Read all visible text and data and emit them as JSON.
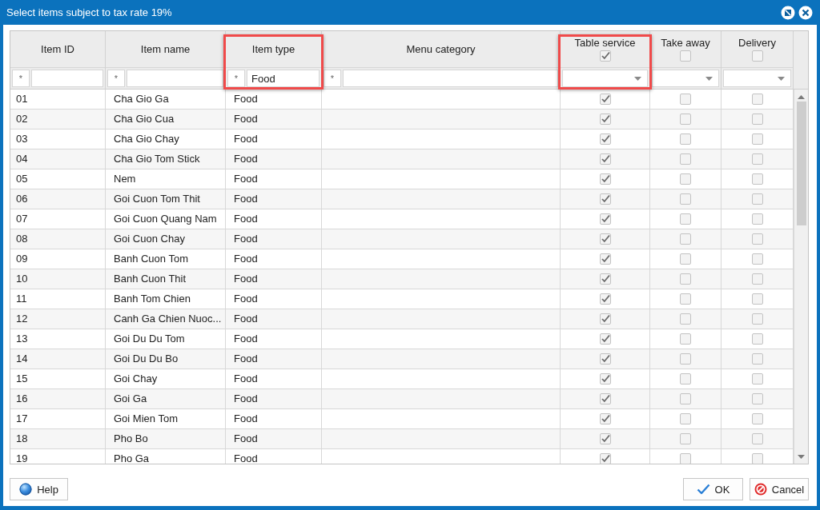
{
  "window": {
    "title": "Select items subject to tax rate 19%"
  },
  "table": {
    "columns": [
      {
        "label": "Item ID",
        "kind": "text",
        "highlighted": false,
        "filter": {
          "operator": "*"
        }
      },
      {
        "label": "Item name",
        "kind": "text",
        "highlighted": false,
        "filter": {
          "operator": "*"
        }
      },
      {
        "label": "Item type",
        "kind": "text",
        "highlighted": true,
        "filter": {
          "operator": "*",
          "value": "Food"
        }
      },
      {
        "label": "Menu category",
        "kind": "text",
        "highlighted": false,
        "filter": {
          "operator": "*"
        }
      },
      {
        "label": "Table service",
        "kind": "check",
        "checked": true,
        "highlighted": true
      },
      {
        "label": "Take away",
        "kind": "check",
        "checked": false,
        "highlighted": false
      },
      {
        "label": "Delivery",
        "kind": "check",
        "checked": false,
        "highlighted": false
      }
    ],
    "rows": [
      {
        "item_id": "01",
        "item_name": "Cha Gio Ga",
        "item_type": "Food",
        "table_service": true,
        "take_away": false,
        "delivery": false
      },
      {
        "item_id": "02",
        "item_name": "Cha Gio Cua",
        "item_type": "Food",
        "table_service": true,
        "take_away": false,
        "delivery": false
      },
      {
        "item_id": "03",
        "item_name": "Cha Gio Chay",
        "item_type": "Food",
        "table_service": true,
        "take_away": false,
        "delivery": false
      },
      {
        "item_id": "04",
        "item_name": "Cha Gio Tom Stick",
        "item_type": "Food",
        "table_service": true,
        "take_away": false,
        "delivery": false
      },
      {
        "item_id": "05",
        "item_name": "Nem",
        "item_type": "Food",
        "table_service": true,
        "take_away": false,
        "delivery": false
      },
      {
        "item_id": "06",
        "item_name": "Goi Cuon Tom Thit",
        "item_type": "Food",
        "table_service": true,
        "take_away": false,
        "delivery": false
      },
      {
        "item_id": "07",
        "item_name": "Goi Cuon Quang Nam",
        "item_type": "Food",
        "table_service": true,
        "take_away": false,
        "delivery": false
      },
      {
        "item_id": "08",
        "item_name": "Goi Cuon Chay",
        "item_type": "Food",
        "table_service": true,
        "take_away": false,
        "delivery": false
      },
      {
        "item_id": "09",
        "item_name": "Banh Cuon Tom",
        "item_type": "Food",
        "table_service": true,
        "take_away": false,
        "delivery": false
      },
      {
        "item_id": "10",
        "item_name": "Banh Cuon Thit",
        "item_type": "Food",
        "table_service": true,
        "take_away": false,
        "delivery": false
      },
      {
        "item_id": "11",
        "item_name": "Banh Tom Chien",
        "item_type": "Food",
        "table_service": true,
        "take_away": false,
        "delivery": false
      },
      {
        "item_id": "12",
        "item_name": "Canh Ga Chien Nuoc...",
        "item_type": "Food",
        "table_service": true,
        "take_away": false,
        "delivery": false
      },
      {
        "item_id": "13",
        "item_name": "Goi Du Du Tom",
        "item_type": "Food",
        "table_service": true,
        "take_away": false,
        "delivery": false
      },
      {
        "item_id": "14",
        "item_name": "Goi Du Du Bo",
        "item_type": "Food",
        "table_service": true,
        "take_away": false,
        "delivery": false
      },
      {
        "item_id": "15",
        "item_name": "Goi Chay",
        "item_type": "Food",
        "table_service": true,
        "take_away": false,
        "delivery": false
      },
      {
        "item_id": "16",
        "item_name": "Goi Ga",
        "item_type": "Food",
        "table_service": true,
        "take_away": false,
        "delivery": false
      },
      {
        "item_id": "17",
        "item_name": "Goi Mien Tom",
        "item_type": "Food",
        "table_service": true,
        "take_away": false,
        "delivery": false
      },
      {
        "item_id": "18",
        "item_name": "Pho Bo",
        "item_type": "Food",
        "table_service": true,
        "take_away": false,
        "delivery": false
      },
      {
        "item_id": "19",
        "item_name": "Pho Ga",
        "item_type": "Food",
        "table_service": true,
        "take_away": false,
        "delivery": false
      }
    ]
  },
  "footer": {
    "left_buttons": [
      {
        "label": "Help",
        "kind": "help"
      }
    ],
    "right_buttons": [
      {
        "label": "OK",
        "kind": "ok"
      },
      {
        "label": "Cancel",
        "kind": "cancel"
      }
    ]
  }
}
